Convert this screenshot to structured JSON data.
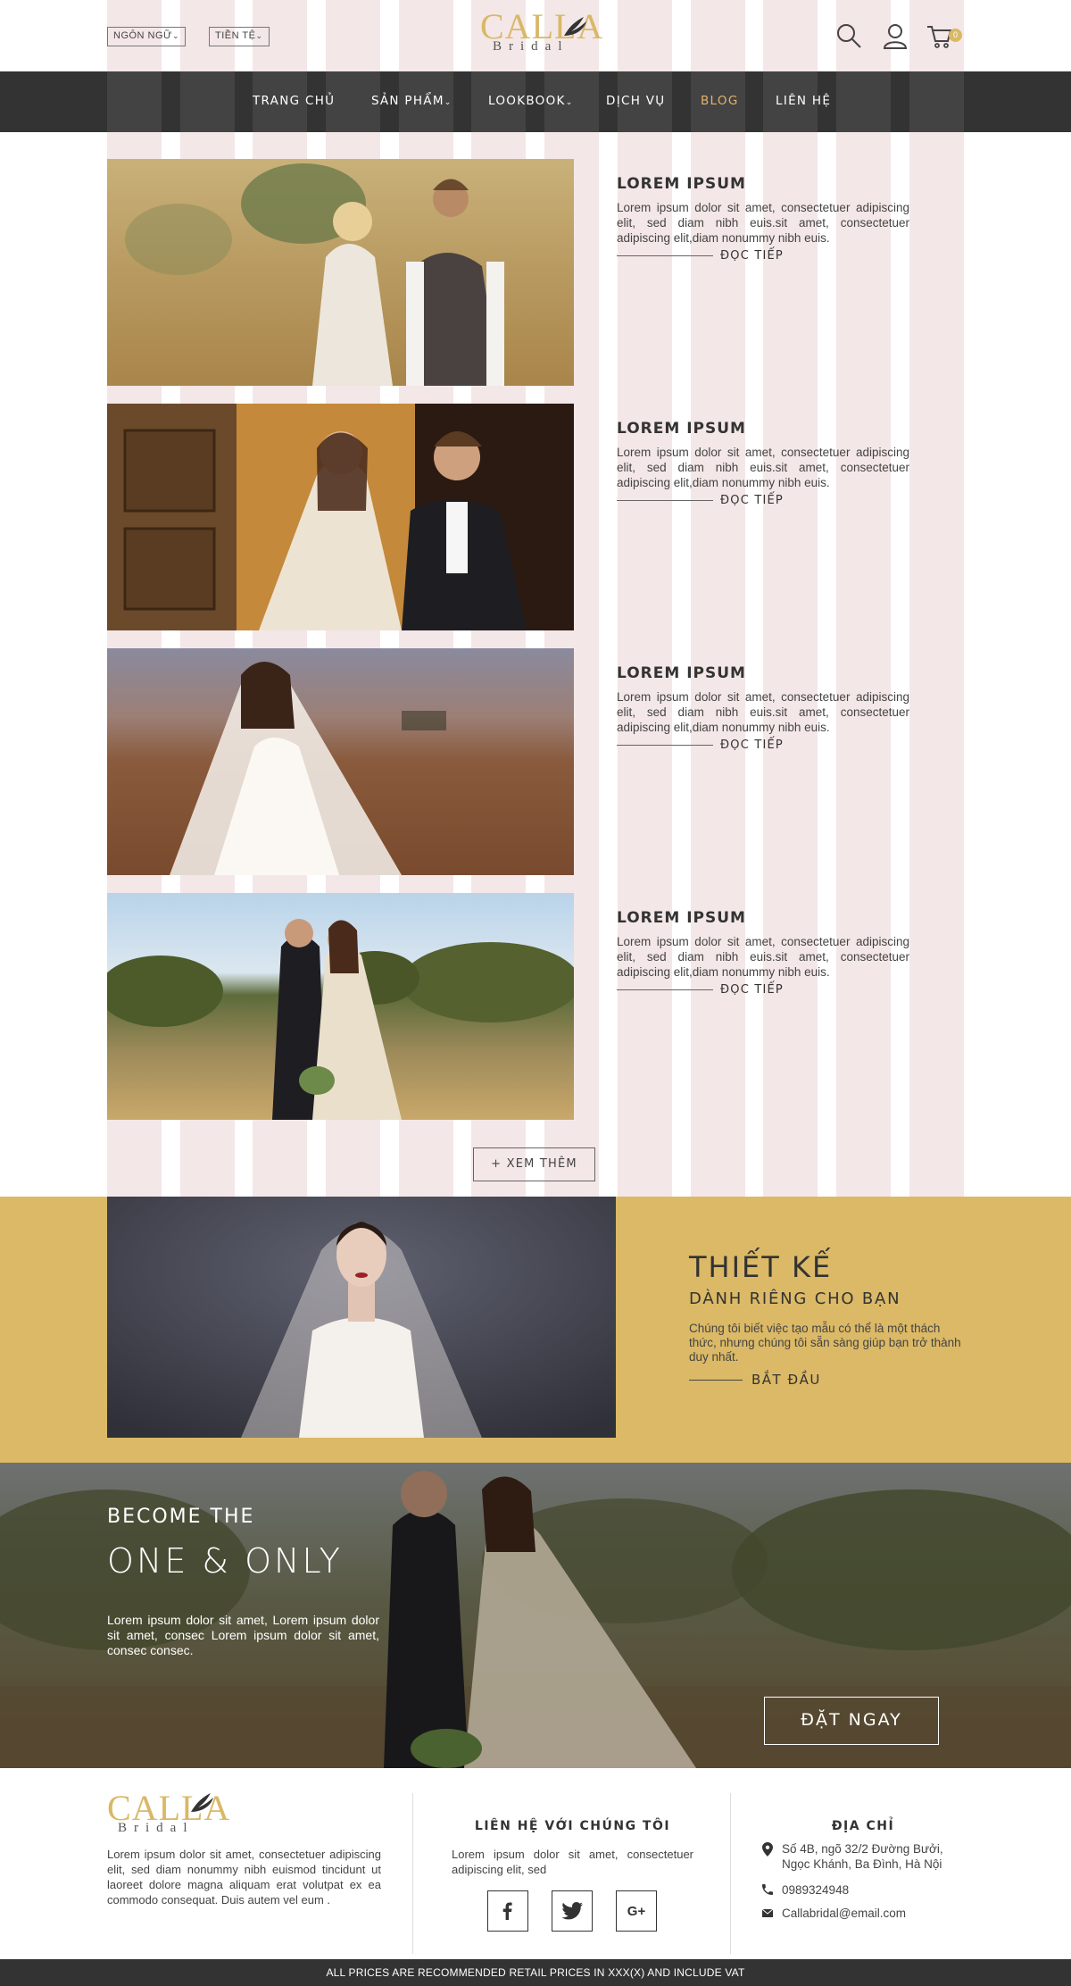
{
  "header": {
    "language_label": "NGÔN NGỮ",
    "currency_label": "TIỀN TỆ",
    "logo_word": "CALLA",
    "logo_sub": "Bridal",
    "cart_count": "0"
  },
  "nav": {
    "items": [
      {
        "label": "TRANG CHỦ"
      },
      {
        "label": "SẢN PHẨM"
      },
      {
        "label": "LOOKBOOK"
      },
      {
        "label": "DỊCH VỤ"
      },
      {
        "label": "BLOG"
      },
      {
        "label": "LIÊN HỆ"
      }
    ],
    "active_color": "#e4b36b"
  },
  "posts": [
    {
      "title": "LOREM IPSUM",
      "excerpt": "Lorem ipsum dolor sit amet, consectetuer adipiscing elit, sed diam nibh euis.sit amet, consectetuer adipiscing elit,diam nonummy nibh euis.",
      "more": "ĐỌC TIẾP"
    },
    {
      "title": "LOREM IPSUM",
      "excerpt": "Lorem ipsum dolor sit amet, consectetuer adipiscing elit, sed diam nibh euis.sit amet, consectetuer adipiscing elit,diam nonummy nibh euis.",
      "more": "ĐỌC TIẾP"
    },
    {
      "title": "LOREM IPSUM",
      "excerpt": "Lorem ipsum dolor sit amet, consectetuer adipiscing elit, sed diam nibh euis.sit amet, consectetuer adipiscing elit,diam nonummy nibh euis.",
      "more": "ĐỌC TIẾP"
    },
    {
      "title": "LOREM IPSUM",
      "excerpt": "Lorem ipsum dolor sit amet, consectetuer adipiscing elit, sed diam nibh euis.sit amet, consectetuer adipiscing elit,diam nonummy nibh euis.",
      "more": "ĐỌC TIẾP"
    }
  ],
  "load_more": "+ XEM THÊM",
  "design": {
    "title": "THIẾT KẾ",
    "subtitle": "DÀNH RIÊNG CHO BẠN",
    "text": "Chúng tôi biết việc tạo mẫu có thể là một thách thức, nhưng chúng tôi sẵn sàng giúp bạn trở thành duy nhất.",
    "cta": "BẮT ĐẦU",
    "bg_color": "#dbb966"
  },
  "hero": {
    "become": "BECOME THE",
    "one_only": "ONE & ONLY",
    "text": "Lorem ipsum dolor sit amet, Lorem ipsum dolor sit amet, consec Lorem ipsum dolor sit amet, consec consec.",
    "button": "ĐẶT NGAY"
  },
  "footer": {
    "about": "Lorem ipsum dolor sit amet, consectetuer adipiscing elit, sed diam nonummy nibh euismod tincidunt ut laoreet dolore magna aliquam erat volutpat ex ea commodo consequat. Duis autem vel eum .",
    "contact_title": "LIÊN HỆ VỚI CHÚNG TÔI",
    "contact_text": "Lorem ipsum dolor sit amet, consectetuer adipiscing elit, sed",
    "address_title": "ĐỊA CHỈ",
    "address": "Số 4B, ngõ 32/2 Đường Bưởi, Ngọc Khánh, Ba Đình, Hà Nội",
    "phone": "0989324948",
    "email": "Callabridal@email.com",
    "social": [
      "facebook-icon",
      "twitter-icon",
      "google-plus-icon"
    ]
  },
  "bottom_bar": "ALL PRICES ARE RECOMMENDED RETAIL PRICES IN XXX(X) AND INCLUDE VAT"
}
